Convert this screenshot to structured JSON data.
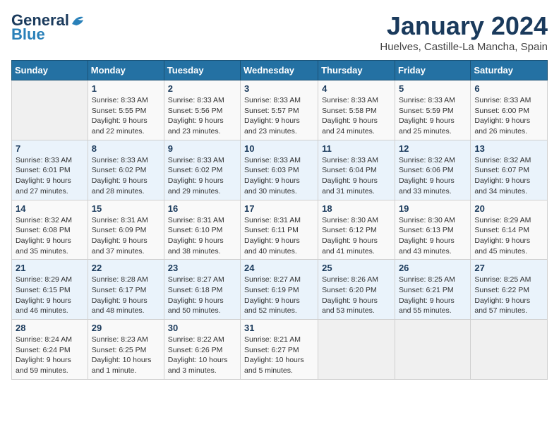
{
  "logo": {
    "general": "General",
    "blue": "Blue"
  },
  "header": {
    "title": "January 2024",
    "subtitle": "Huelves, Castille-La Mancha, Spain"
  },
  "weekdays": [
    "Sunday",
    "Monday",
    "Tuesday",
    "Wednesday",
    "Thursday",
    "Friday",
    "Saturday"
  ],
  "weeks": [
    [
      {
        "num": "",
        "info": ""
      },
      {
        "num": "1",
        "info": "Sunrise: 8:33 AM\nSunset: 5:55 PM\nDaylight: 9 hours\nand 22 minutes."
      },
      {
        "num": "2",
        "info": "Sunrise: 8:33 AM\nSunset: 5:56 PM\nDaylight: 9 hours\nand 23 minutes."
      },
      {
        "num": "3",
        "info": "Sunrise: 8:33 AM\nSunset: 5:57 PM\nDaylight: 9 hours\nand 23 minutes."
      },
      {
        "num": "4",
        "info": "Sunrise: 8:33 AM\nSunset: 5:58 PM\nDaylight: 9 hours\nand 24 minutes."
      },
      {
        "num": "5",
        "info": "Sunrise: 8:33 AM\nSunset: 5:59 PM\nDaylight: 9 hours\nand 25 minutes."
      },
      {
        "num": "6",
        "info": "Sunrise: 8:33 AM\nSunset: 6:00 PM\nDaylight: 9 hours\nand 26 minutes."
      }
    ],
    [
      {
        "num": "7",
        "info": "Sunrise: 8:33 AM\nSunset: 6:01 PM\nDaylight: 9 hours\nand 27 minutes."
      },
      {
        "num": "8",
        "info": "Sunrise: 8:33 AM\nSunset: 6:02 PM\nDaylight: 9 hours\nand 28 minutes."
      },
      {
        "num": "9",
        "info": "Sunrise: 8:33 AM\nSunset: 6:02 PM\nDaylight: 9 hours\nand 29 minutes."
      },
      {
        "num": "10",
        "info": "Sunrise: 8:33 AM\nSunset: 6:03 PM\nDaylight: 9 hours\nand 30 minutes."
      },
      {
        "num": "11",
        "info": "Sunrise: 8:33 AM\nSunset: 6:04 PM\nDaylight: 9 hours\nand 31 minutes."
      },
      {
        "num": "12",
        "info": "Sunrise: 8:32 AM\nSunset: 6:06 PM\nDaylight: 9 hours\nand 33 minutes."
      },
      {
        "num": "13",
        "info": "Sunrise: 8:32 AM\nSunset: 6:07 PM\nDaylight: 9 hours\nand 34 minutes."
      }
    ],
    [
      {
        "num": "14",
        "info": "Sunrise: 8:32 AM\nSunset: 6:08 PM\nDaylight: 9 hours\nand 35 minutes."
      },
      {
        "num": "15",
        "info": "Sunrise: 8:31 AM\nSunset: 6:09 PM\nDaylight: 9 hours\nand 37 minutes."
      },
      {
        "num": "16",
        "info": "Sunrise: 8:31 AM\nSunset: 6:10 PM\nDaylight: 9 hours\nand 38 minutes."
      },
      {
        "num": "17",
        "info": "Sunrise: 8:31 AM\nSunset: 6:11 PM\nDaylight: 9 hours\nand 40 minutes."
      },
      {
        "num": "18",
        "info": "Sunrise: 8:30 AM\nSunset: 6:12 PM\nDaylight: 9 hours\nand 41 minutes."
      },
      {
        "num": "19",
        "info": "Sunrise: 8:30 AM\nSunset: 6:13 PM\nDaylight: 9 hours\nand 43 minutes."
      },
      {
        "num": "20",
        "info": "Sunrise: 8:29 AM\nSunset: 6:14 PM\nDaylight: 9 hours\nand 45 minutes."
      }
    ],
    [
      {
        "num": "21",
        "info": "Sunrise: 8:29 AM\nSunset: 6:15 PM\nDaylight: 9 hours\nand 46 minutes."
      },
      {
        "num": "22",
        "info": "Sunrise: 8:28 AM\nSunset: 6:17 PM\nDaylight: 9 hours\nand 48 minutes."
      },
      {
        "num": "23",
        "info": "Sunrise: 8:27 AM\nSunset: 6:18 PM\nDaylight: 9 hours\nand 50 minutes."
      },
      {
        "num": "24",
        "info": "Sunrise: 8:27 AM\nSunset: 6:19 PM\nDaylight: 9 hours\nand 52 minutes."
      },
      {
        "num": "25",
        "info": "Sunrise: 8:26 AM\nSunset: 6:20 PM\nDaylight: 9 hours\nand 53 minutes."
      },
      {
        "num": "26",
        "info": "Sunrise: 8:25 AM\nSunset: 6:21 PM\nDaylight: 9 hours\nand 55 minutes."
      },
      {
        "num": "27",
        "info": "Sunrise: 8:25 AM\nSunset: 6:22 PM\nDaylight: 9 hours\nand 57 minutes."
      }
    ],
    [
      {
        "num": "28",
        "info": "Sunrise: 8:24 AM\nSunset: 6:24 PM\nDaylight: 9 hours\nand 59 minutes."
      },
      {
        "num": "29",
        "info": "Sunrise: 8:23 AM\nSunset: 6:25 PM\nDaylight: 10 hours\nand 1 minute."
      },
      {
        "num": "30",
        "info": "Sunrise: 8:22 AM\nSunset: 6:26 PM\nDaylight: 10 hours\nand 3 minutes."
      },
      {
        "num": "31",
        "info": "Sunrise: 8:21 AM\nSunset: 6:27 PM\nDaylight: 10 hours\nand 5 minutes."
      },
      {
        "num": "",
        "info": ""
      },
      {
        "num": "",
        "info": ""
      },
      {
        "num": "",
        "info": ""
      }
    ]
  ]
}
